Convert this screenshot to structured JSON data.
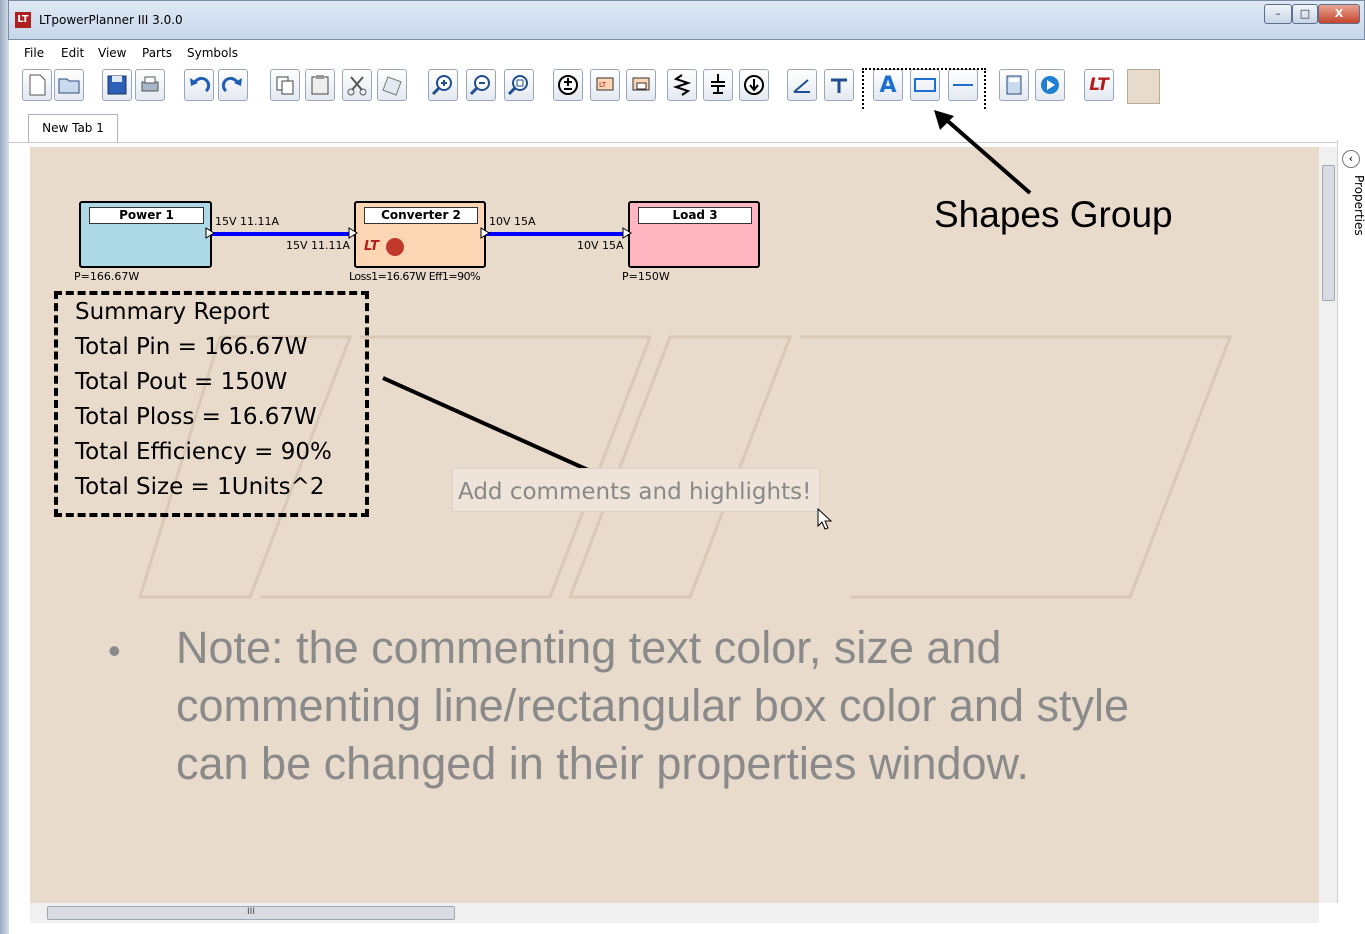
{
  "window": {
    "title": "LTpowerPlanner III 3.0.0",
    "app_icon": "LT",
    "minimize": "–",
    "maximize": "□",
    "close": "X"
  },
  "menu": [
    "File",
    "Edit",
    "View",
    "Parts",
    "Symbols"
  ],
  "toolbar_icons": [
    "new-file-icon",
    "open-folder-icon",
    "save-icon",
    "print-icon",
    "undo-icon",
    "redo-icon",
    "copy-icon",
    "paste-icon",
    "cut-icon",
    "delete-icon",
    "zoom-in-icon",
    "zoom-out-icon",
    "zoom-fit-icon",
    "power-source-icon",
    "converter-icon",
    "load-icon",
    "resistor-icon",
    "capacitor-ground-icon",
    "current-sink-icon",
    "line-tool-icon",
    "text-tool-icon",
    "text-shape-icon",
    "rectangle-shape-icon",
    "line-shape-icon",
    "calculator-icon",
    "run-icon",
    "lt-logo-icon",
    "color-swatch-icon"
  ],
  "colors": {
    "canvas": "#e9dbcc",
    "wire": "#0000ff",
    "power": "#add8e6",
    "converter": "#fcd5b4",
    "load": "#ffb6c1"
  },
  "tab": {
    "label": "New Tab 1"
  },
  "panel": {
    "label": "Properties",
    "scroll_thumb": "III"
  },
  "blocks": {
    "power": {
      "title": "Power 1",
      "power": "P=166.67W",
      "out": "15V 11.11A"
    },
    "converter": {
      "title": "Converter 2",
      "in": "15V 11.11A",
      "out": "10V 15A",
      "loss": "Loss1=16.67W Eff1=90%"
    },
    "load": {
      "title": "Load 3",
      "in": "10V 15A",
      "power": "P=150W"
    }
  },
  "summary": {
    "lines": [
      "Summary Report",
      "Total Pin = 166.67W",
      "Total Pout = 150W",
      "Total Ploss = 16.67W",
      "Total Efficiency = 90%",
      "Total Size = 1Units^2"
    ]
  },
  "comment": {
    "text": "Add comments and highlights!"
  },
  "note": {
    "bullet": "•",
    "lines": [
      "Note: the commenting text color, size and",
      "commenting line/rectangular box color and style",
      "can be changed in their properties window."
    ]
  },
  "callout": {
    "label": "Shapes Group"
  }
}
